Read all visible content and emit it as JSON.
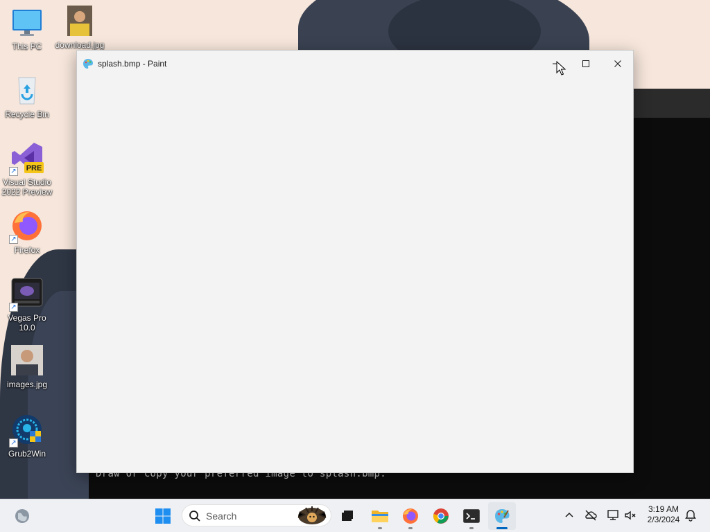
{
  "desktop": {
    "icons": [
      {
        "label": "This PC"
      },
      {
        "label": "download.jpg"
      },
      {
        "label": "Recycle Bin"
      },
      {
        "label": "Visual Studio 2022 Preview",
        "badge": "PRE"
      },
      {
        "label": "Firefox"
      },
      {
        "label": "Vegas Pro 10.0"
      },
      {
        "label": "images.jpg"
      },
      {
        "label": "Grub2Win"
      }
    ]
  },
  "terminal": {
    "line": "Draw or copy your preferred image to splash.bmp."
  },
  "paint_window": {
    "title": "splash.bmp - Paint",
    "buttons": {
      "minimize": "minimize",
      "maximize": "maximize",
      "close": "close"
    }
  },
  "taskbar": {
    "search_placeholder": "Search",
    "apps": [
      {
        "name": "start-button",
        "icon": "windows-logo-icon"
      },
      {
        "name": "task-view-button",
        "icon": "task-view-icon"
      },
      {
        "name": "file-explorer",
        "icon": "folder-icon",
        "running": true
      },
      {
        "name": "firefox",
        "icon": "firefox-icon",
        "running": true
      },
      {
        "name": "chrome",
        "icon": "chrome-icon",
        "running": false
      },
      {
        "name": "terminal",
        "icon": "terminal-icon",
        "running": true
      },
      {
        "name": "paint",
        "icon": "paint-icon",
        "running": true,
        "active": true
      }
    ],
    "clock": {
      "time": "3:19 AM",
      "date": "2/3/2024"
    }
  },
  "colors": {
    "accent": "#0067c0",
    "taskbar_bg": "#eef0f3",
    "paint_bg": "#f3f3f3"
  }
}
